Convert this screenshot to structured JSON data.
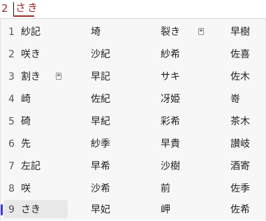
{
  "ime": {
    "prefix": "2",
    "composition": "さき"
  },
  "candidates": {
    "selected_index": 9,
    "rows": [
      {
        "index": "1",
        "items": [
          "紗記",
          "埼",
          "裂き",
          "早樹"
        ],
        "dict_icon_col": 3
      },
      {
        "index": "2",
        "items": [
          "咲き",
          "沙紀",
          "紗希",
          "佐喜"
        ]
      },
      {
        "index": "3",
        "items": [
          "割き",
          "早記",
          "サキ",
          "佐木"
        ],
        "dict_icon_col": 1
      },
      {
        "index": "4",
        "items": [
          "崎",
          "佐紀",
          "冴姫",
          "嵜"
        ]
      },
      {
        "index": "5",
        "items": [
          "碕",
          "早紀",
          "彩希",
          "茶木"
        ]
      },
      {
        "index": "6",
        "items": [
          "先",
          "紗季",
          "早貴",
          "讃岐"
        ]
      },
      {
        "index": "7",
        "items": [
          "左記",
          "早希",
          "沙樹",
          "酒寄"
        ]
      },
      {
        "index": "8",
        "items": [
          "咲",
          "沙希",
          "前",
          "佐季"
        ]
      },
      {
        "index": "9",
        "items": [
          "さき",
          "早妃",
          "岬",
          "佐希"
        ]
      }
    ]
  },
  "icons": {
    "dictionary": "dictionary-icon",
    "selection_marker": "selection-marker"
  },
  "colors": {
    "composition_text": "#9b2d2d",
    "selection_marker": "#3b3bd4",
    "selected_background": "#e8e8e8",
    "panel_background": "#f7f7f7"
  }
}
